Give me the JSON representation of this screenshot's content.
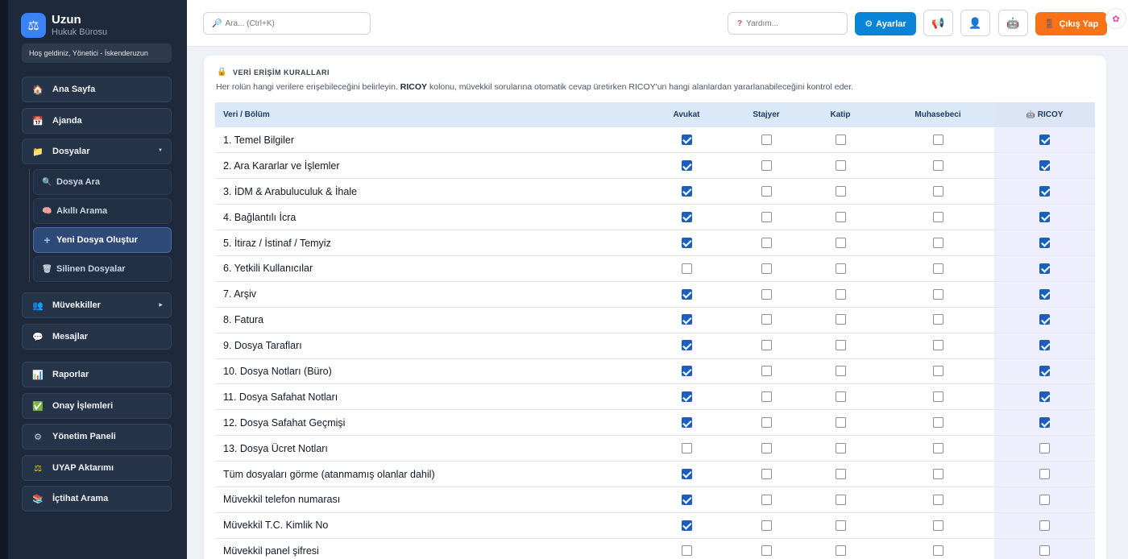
{
  "brand": {
    "name": "Uzun",
    "subtitle": "Hukuk Bürosu",
    "logo_icon": "scales-icon"
  },
  "welcome": "Hoş geldiniz, Yönetici - İskenderuzun",
  "sidebar": {
    "items": [
      {
        "label": "Ana Sayfa",
        "icon": "🏠"
      },
      {
        "label": "Ajanda",
        "icon": "📅"
      },
      {
        "label": "Dosyalar",
        "icon": "📁"
      },
      {
        "label": "Müvekkiller",
        "icon": "👥"
      },
      {
        "label": "Mesajlar",
        "icon": "💬"
      },
      {
        "label": "Raporlar",
        "icon": "📊"
      },
      {
        "label": "Onay İşlemleri",
        "icon": "✅"
      },
      {
        "label": "Yönetim Paneli",
        "icon": "⚙"
      },
      {
        "label": "UYAP Aktarımı",
        "icon": "⚖"
      },
      {
        "label": "İçtihat Arama",
        "icon": "📚"
      }
    ],
    "subitems": [
      {
        "label": "Dosya Ara",
        "icon": "🔍"
      },
      {
        "label": "Akıllı Arama",
        "icon": "🧠"
      },
      {
        "label": "Yeni Dosya Oluştur",
        "icon": "+"
      },
      {
        "label": "Silinen Dosyalar",
        "icon": "🗑"
      }
    ]
  },
  "header": {
    "search_placeholder": "Ara... (Ctrl+K)",
    "help_placeholder": "Yardım...",
    "settings_label": "Ayarlar",
    "logout_label": "Çıkış Yap"
  },
  "card": {
    "title": "VERİ ERİŞİM KURALLARI",
    "desc_prefix": "Her rolün hangi verilere erişebileceğini belirleyin.",
    "desc_bold": "RICOY",
    "desc_suffix": "kolonu, müvekkil sorularına otomatik cevap üretirken RICOY'un hangi alanlardan yararlanabileceğini kontrol eder."
  },
  "table": {
    "columns": [
      "Veri / Bölüm",
      "Avukat",
      "Stajyer",
      "Katip",
      "Muhasebeci",
      "RICOY"
    ],
    "rows": [
      {
        "label": "1. Temel Bilgiler",
        "values": [
          true,
          false,
          false,
          false,
          true
        ]
      },
      {
        "label": "2. Ara Kararlar ve İşlemler",
        "values": [
          true,
          false,
          false,
          false,
          true
        ]
      },
      {
        "label": "3. İDM & Arabuluculuk & İhale",
        "values": [
          true,
          false,
          false,
          false,
          true
        ]
      },
      {
        "label": "4. Bağlantılı İcra",
        "values": [
          true,
          false,
          false,
          false,
          true
        ]
      },
      {
        "label": "5. İtiraz / İstinaf / Temyiz",
        "values": [
          true,
          false,
          false,
          false,
          true
        ]
      },
      {
        "label": "6. Yetkili Kullanıcılar",
        "values": [
          false,
          false,
          false,
          false,
          true
        ]
      },
      {
        "label": "7. Arşiv",
        "values": [
          true,
          false,
          false,
          false,
          true
        ]
      },
      {
        "label": "8. Fatura",
        "values": [
          true,
          false,
          false,
          false,
          true
        ]
      },
      {
        "label": "9. Dosya Tarafları",
        "values": [
          true,
          false,
          false,
          false,
          true
        ]
      },
      {
        "label": "10. Dosya Notları (Büro)",
        "values": [
          true,
          false,
          false,
          false,
          true
        ]
      },
      {
        "label": "11. Dosya Safahat Notları",
        "values": [
          true,
          false,
          false,
          false,
          true
        ]
      },
      {
        "label": "12. Dosya Safahat Geçmişi",
        "values": [
          true,
          false,
          false,
          false,
          true
        ]
      },
      {
        "label": "13. Dosya Ücret Notları",
        "values": [
          false,
          false,
          false,
          false,
          false
        ]
      },
      {
        "label": "Tüm dosyaları görme (atanmamış olanlar dahil)",
        "values": [
          true,
          false,
          false,
          false,
          false
        ]
      },
      {
        "label": "Müvekkil telefon numarası",
        "values": [
          true,
          false,
          false,
          false,
          false
        ]
      },
      {
        "label": "Müvekkil T.C. Kimlik No",
        "values": [
          true,
          false,
          false,
          false,
          false
        ]
      },
      {
        "label": "Müvekkil panel şifresi",
        "values": [
          false,
          false,
          false,
          false,
          false
        ]
      }
    ]
  }
}
